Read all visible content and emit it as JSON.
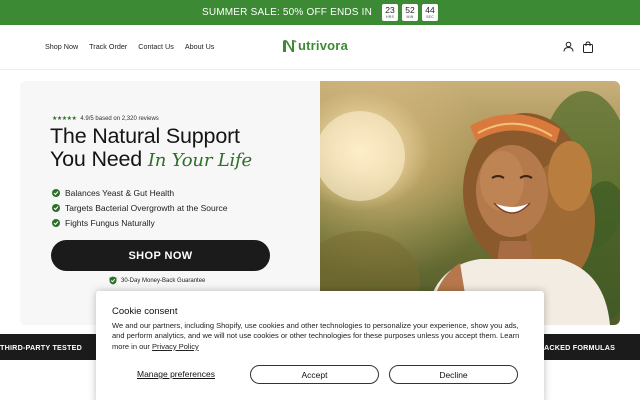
{
  "announcement": {
    "text": "SUMMER SALE: 50% OFF ENDS IN",
    "timer": [
      {
        "value": "23",
        "unit": "HRS"
      },
      {
        "value": "52",
        "unit": "MIN"
      },
      {
        "value": "44",
        "unit": "SEC"
      }
    ]
  },
  "nav": {
    "items": [
      "Shop Now",
      "Track Order",
      "Contact Us",
      "About Us"
    ]
  },
  "brand": {
    "name": "utrivora",
    "color": "#3d8a34"
  },
  "hero": {
    "rating_text": "4.9/5 based on 2,320 reviews",
    "stars": "★★★★★",
    "headline_line1": "The Natural Support",
    "headline_line2": "You Need",
    "headline_accent": "In Your Life",
    "benefits": [
      "Balances Yeast & Gut Health",
      "Targets Bacterial Overgrowth at the Source",
      "Fights Fungus Naturally"
    ],
    "cta_label": "SHOP NOW",
    "guarantee": "30-Day Money-Back Guarantee"
  },
  "trust_strip": {
    "left": "THIRD-PARTY TESTED",
    "right": "ACKED FORMULAS"
  },
  "cookie": {
    "title": "Cookie consent",
    "body": "We and our partners, including Shopify, use cookies and other technologies to personalize your experience, show you ads, and perform analytics, and we will not use cookies or other technologies for these purposes unless you accept them. Learn more in our ",
    "policy_link": "Privacy Policy",
    "manage_label": "Manage preferences",
    "accept_label": "Accept",
    "decline_label": "Decline"
  },
  "colors": {
    "accent_green": "#3d8a34",
    "dark_green": "#2f6e2a",
    "dark": "#1b1b1b"
  }
}
